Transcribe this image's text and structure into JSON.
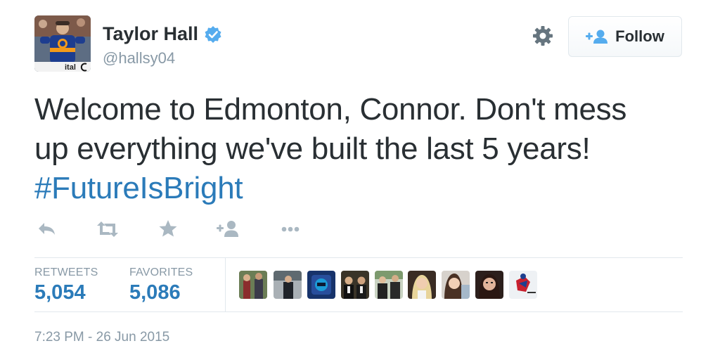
{
  "author": {
    "display_name": "Taylor Hall",
    "handle": "@hallsy04",
    "avatar_icon": "profile-photo-hockey-player",
    "verified_icon": "verified-badge-icon",
    "avatar_sign_text": "ital"
  },
  "header": {
    "settings_icon": "gear-icon",
    "follow_label": "Follow",
    "follow_icon": "add-user-icon"
  },
  "tweet": {
    "text_line1": "Welcome to Edmonton, Connor. Don't mess",
    "text_line2": "up everything we've built the last 5 years!",
    "hashtag": "#FutureIsBright"
  },
  "actions": [
    {
      "name": "reply",
      "icon": "reply-icon"
    },
    {
      "name": "retweet",
      "icon": "retweet-icon"
    },
    {
      "name": "favorite",
      "icon": "star-icon"
    },
    {
      "name": "follow",
      "icon": "add-user-icon"
    },
    {
      "name": "more",
      "icon": "more-dots-icon"
    }
  ],
  "stats": {
    "retweets_label": "RETWEETS",
    "retweets_value": "5,054",
    "favorites_label": "FAVORITES",
    "favorites_value": "5,086"
  },
  "favorited_by_count_shown": 9,
  "timestamp": "7:23 PM - 26 Jun 2015",
  "colors": {
    "link_blue": "#2b7bb9",
    "muted_gray": "#8899a6",
    "text_dark": "#292f33",
    "verified_blue": "#55acee",
    "border": "#e1e8ed"
  }
}
